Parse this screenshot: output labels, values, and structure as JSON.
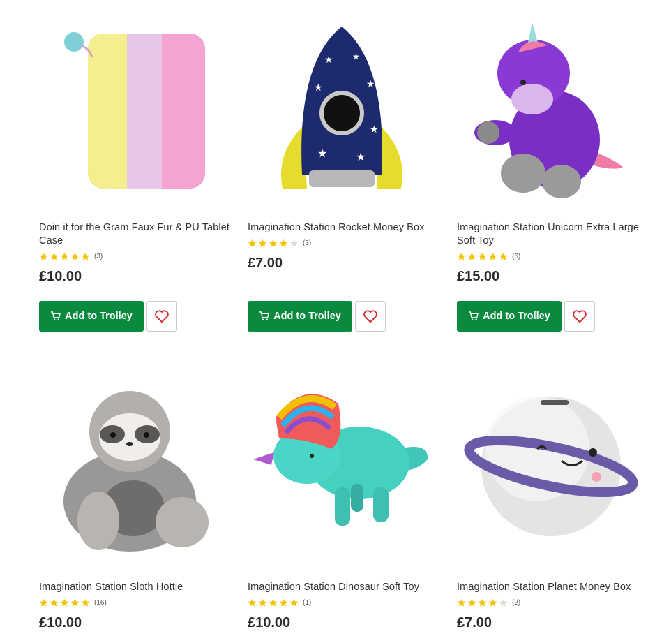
{
  "colors": {
    "accent": "#0a8a3e",
    "star": "#f2c200",
    "star_empty": "#dddddd",
    "heart": "#d9272e"
  },
  "products": [
    {
      "title": "Doin it for the Gram Faux Fur & PU Tablet Case",
      "rating": 5,
      "reviews": "(3)",
      "price": "£10.00",
      "add_label": "Add to Trolley"
    },
    {
      "title": "Imagination Station Rocket Money Box",
      "rating": 4,
      "reviews": "(3)",
      "price": "£7.00",
      "add_label": "Add to Trolley"
    },
    {
      "title": "Imagination Station Unicorn Extra Large Soft Toy",
      "rating": 5,
      "reviews": "(6)",
      "price": "£15.00",
      "add_label": "Add to Trolley"
    },
    {
      "title": "Imagination Station Sloth Hottie",
      "rating": 5,
      "reviews": "(16)",
      "price": "£10.00"
    },
    {
      "title": "Imagination Station Dinosaur Soft Toy",
      "rating": 5,
      "reviews": "(1)",
      "price": "£10.00"
    },
    {
      "title": "Imagination Station Planet Money Box",
      "rating": 4,
      "reviews": "(2)",
      "price": "£7.00"
    }
  ]
}
